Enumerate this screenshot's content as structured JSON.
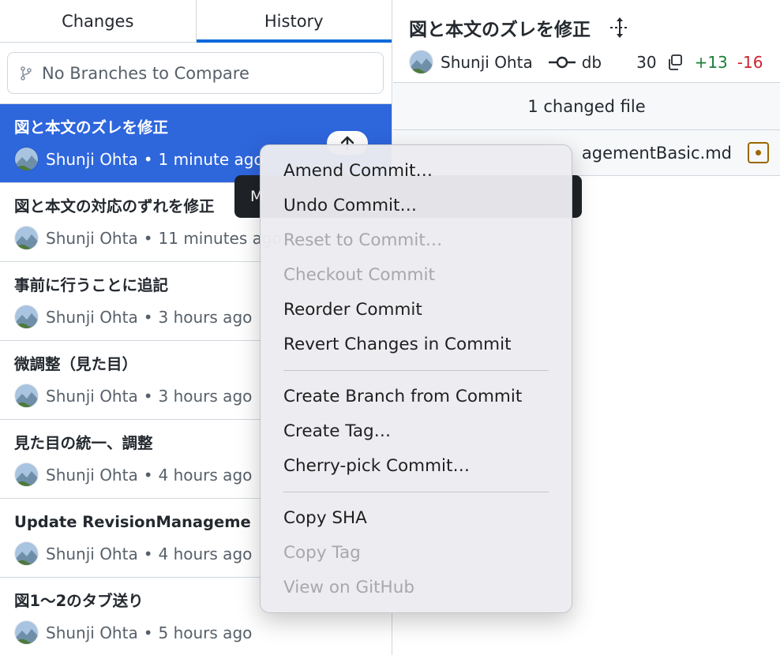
{
  "tabs": {
    "changes": "Changes",
    "history": "History"
  },
  "compare": {
    "placeholder": "No Branches to Compare"
  },
  "commits": [
    {
      "title": "図と本文のズレを修正",
      "author": "Shunji Ohta",
      "time": "1 minute ago"
    },
    {
      "title": "図と本文の対応のずれを修正",
      "author": "Shunji Ohta",
      "time": "11 minutes ago"
    },
    {
      "title": "事前に行うことに追記",
      "author": "Shunji Ohta",
      "time": "3 hours ago"
    },
    {
      "title": "微調整（見た目）",
      "author": "Shunji Ohta",
      "time": "3 hours ago"
    },
    {
      "title": "見た目の統一、調整",
      "author": "Shunji Ohta",
      "time": "4 hours ago"
    },
    {
      "title": "Update RevisionManageme",
      "author": "Shunji Ohta",
      "time": "4 hours ago"
    },
    {
      "title": "図1〜2のタブ送り",
      "author": "Shunji Ohta",
      "time": "5 hours ago"
    }
  ],
  "meta_separator": "•",
  "detail": {
    "title": "図と本文のズレを修正",
    "author": "Shunji Ohta",
    "sha_start": "db",
    "sha_end": "30",
    "additions": "+13",
    "deletions": "-16",
    "changed_files": "1 changed file",
    "file_name": "agementBasic.md"
  },
  "tooltip": {
    "text": "M"
  },
  "menu": {
    "group1": [
      {
        "label": "Amend Commit…",
        "enabled": true
      },
      {
        "label": "Undo Commit…",
        "enabled": true
      },
      {
        "label": "Reset to Commit…",
        "enabled": false
      },
      {
        "label": "Checkout Commit",
        "enabled": false
      },
      {
        "label": "Reorder Commit",
        "enabled": true
      },
      {
        "label": "Revert Changes in Commit",
        "enabled": true
      }
    ],
    "group2": [
      {
        "label": "Create Branch from Commit",
        "enabled": true
      },
      {
        "label": "Create Tag…",
        "enabled": true
      },
      {
        "label": "Cherry-pick Commit…",
        "enabled": true
      }
    ],
    "group3": [
      {
        "label": "Copy SHA",
        "enabled": true
      },
      {
        "label": "Copy Tag",
        "enabled": false
      },
      {
        "label": "View on GitHub",
        "enabled": false
      }
    ]
  },
  "colors": {
    "accent": "#0969da",
    "selection": "#2e66dc",
    "additions": "#1a7f37",
    "deletions": "#cf222e",
    "modified": "#9a6700"
  },
  "icons": [
    "branch-icon",
    "avatar",
    "push-arrow-icon",
    "move-icon",
    "commit-icon",
    "copy-icon",
    "modified-file-icon"
  ]
}
